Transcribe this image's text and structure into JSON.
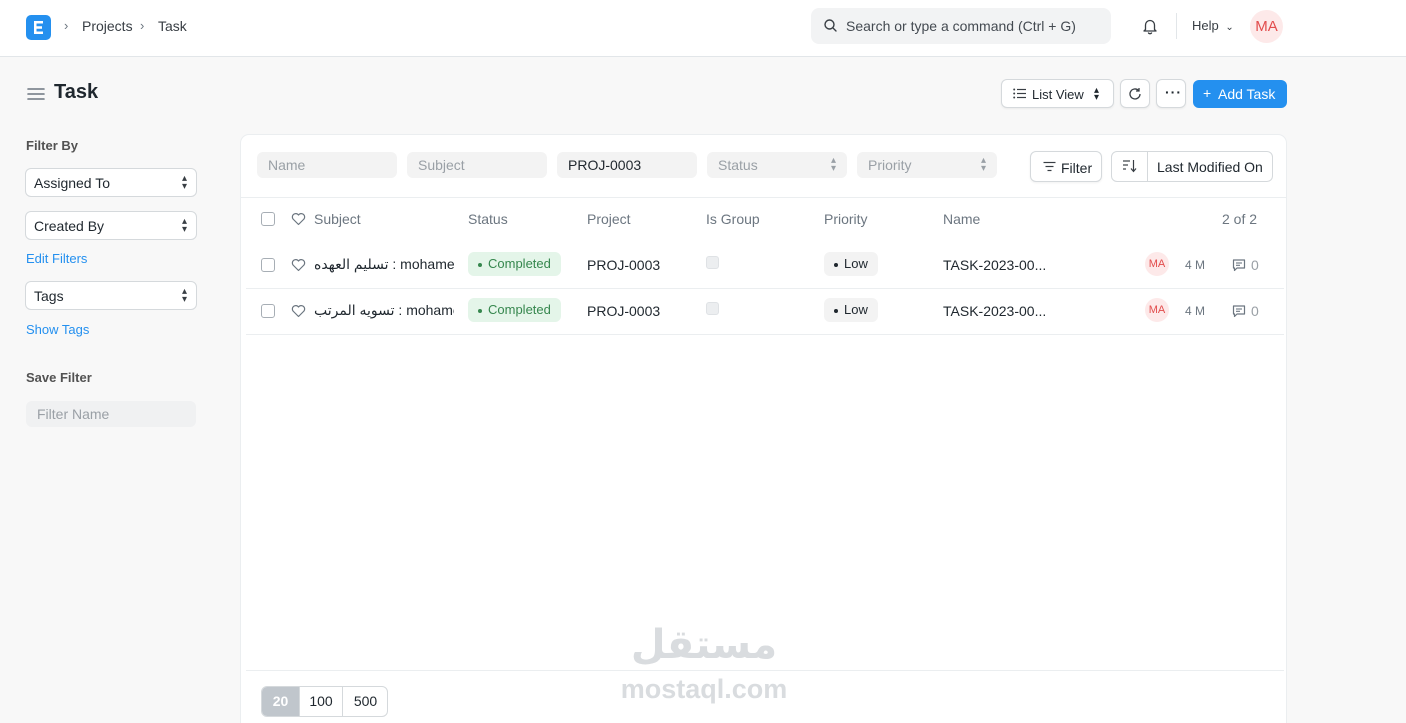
{
  "navbar": {
    "breadcrumbs": [
      "Projects",
      "Task"
    ],
    "search_placeholder": "Search or type a command (Ctrl + G)",
    "help_label": "Help",
    "user_initials": "MA"
  },
  "page": {
    "title": "Task",
    "list_view_label": "List View",
    "add_button_label": "Add Task"
  },
  "sidebar": {
    "filter_by_heading": "Filter By",
    "assigned_to_label": "Assigned To",
    "created_by_label": "Created By",
    "edit_filters_label": "Edit Filters",
    "tags_label": "Tags",
    "show_tags_label": "Show Tags",
    "save_filter_heading": "Save Filter",
    "filter_name_placeholder": "Filter Name"
  },
  "filters": {
    "name_placeholder": "Name",
    "subject_placeholder": "Subject",
    "project_value": "PROJ-0003",
    "status_placeholder": "Status",
    "priority_placeholder": "Priority",
    "filter_button_label": "Filter",
    "sort_label": "Last Modified On"
  },
  "table": {
    "columns": [
      "Subject",
      "Status",
      "Project",
      "Is Group",
      "Priority",
      "Name"
    ],
    "count_label": "2 of 2",
    "rows": [
      {
        "subject": "تسليم العهده : mohamed",
        "status": "Completed",
        "project": "PROJ-0003",
        "is_group": false,
        "priority": "Low",
        "name": "TASK-2023-00...",
        "assignee_initials": "MA",
        "modified": "4 M",
        "comments": "0"
      },
      {
        "subject": "تسويه المرتب : mohamed",
        "status": "Completed",
        "project": "PROJ-0003",
        "is_group": false,
        "priority": "Low",
        "name": "TASK-2023-00...",
        "assignee_initials": "MA",
        "modified": "4 M",
        "comments": "0"
      }
    ]
  },
  "pagination": {
    "page_sizes": [
      "20",
      "100",
      "500"
    ],
    "selected": "20"
  },
  "watermark": {
    "arabic": "مستقل",
    "latin": "mostaql.com"
  },
  "colors": {
    "primary": "#2490ef",
    "completed_bg": "#e4f5e9",
    "completed_text": "#36874e",
    "avatar_bg": "#fde9e9",
    "avatar_text": "#e24c4c"
  }
}
